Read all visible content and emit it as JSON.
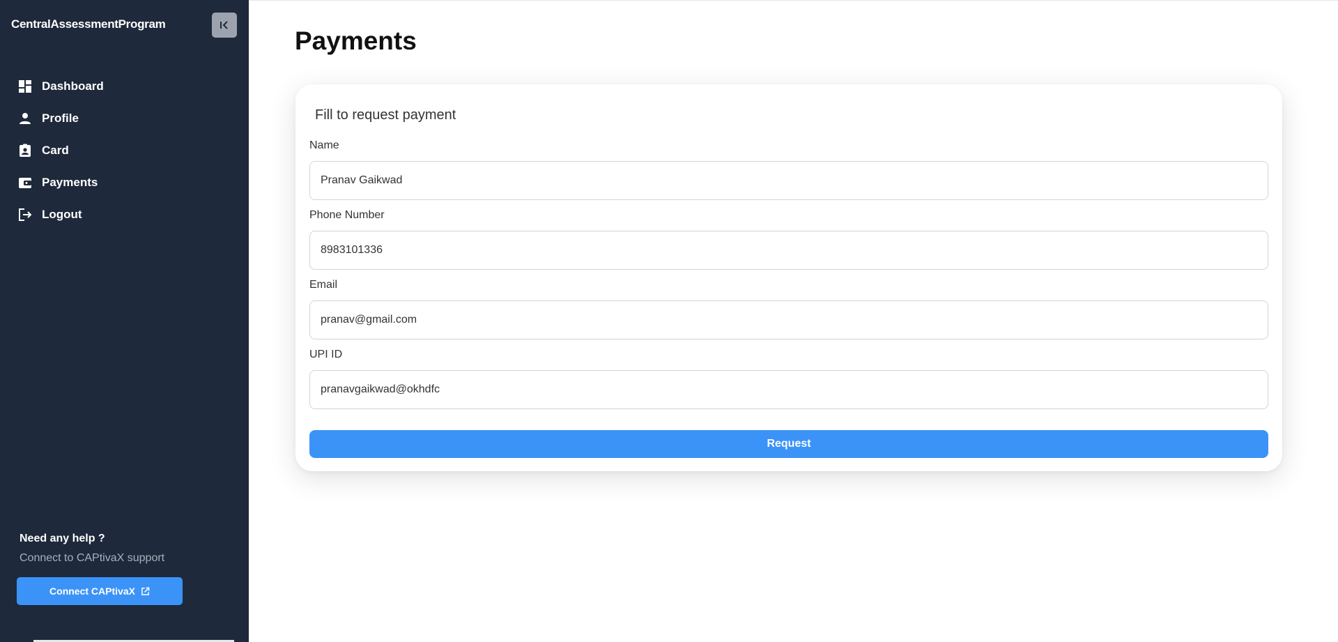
{
  "sidebar": {
    "brand": "CentralAssessmentProgram",
    "items": [
      {
        "label": "Dashboard",
        "icon": "dashboard-icon"
      },
      {
        "label": "Profile",
        "icon": "person-icon"
      },
      {
        "label": "Card",
        "icon": "id-card-icon"
      },
      {
        "label": "Payments",
        "icon": "wallet-icon"
      },
      {
        "label": "Logout",
        "icon": "logout-icon"
      }
    ],
    "help": {
      "title": "Need any help ?",
      "subtitle": "Connect to CAPtivaX support",
      "button_label": "Connect CAPtivaX"
    }
  },
  "main": {
    "title": "Payments",
    "form": {
      "heading": "Fill to request payment",
      "fields": [
        {
          "label": "Name",
          "value": "Pranav Gaikwad"
        },
        {
          "label": "Phone Number",
          "value": "8983101336"
        },
        {
          "label": "Email",
          "value": "pranav@gmail.com"
        },
        {
          "label": "UPI ID",
          "value": "pranavgaikwad@okhdfc"
        }
      ],
      "submit_label": "Request"
    }
  },
  "colors": {
    "sidebar_bg": "#1e293b",
    "accent": "#3b93f7"
  }
}
